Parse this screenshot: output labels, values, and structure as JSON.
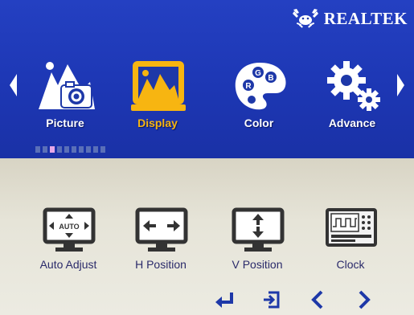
{
  "brand": {
    "name": "REALTEK",
    "logo_icon": "crab-logo-icon"
  },
  "colors": {
    "top_bg": "#1e38a8",
    "bottom_bg": "#e6e4d8",
    "active_label": "#f7b511",
    "label": "#ffffff",
    "sub_label": "#2a2a6a"
  },
  "main_menu": {
    "items": [
      {
        "label": "Picture",
        "icon": "picture-icon",
        "selected": false
      },
      {
        "label": "Display",
        "icon": "display-icon",
        "selected": true
      },
      {
        "label": "Color",
        "icon": "palette-icon",
        "selected": false
      },
      {
        "label": "Advance",
        "icon": "gears-icon",
        "selected": false
      }
    ],
    "page_count": 10,
    "current_page": 1
  },
  "submenu": {
    "items": [
      {
        "label": "Auto Adjust",
        "icon": "auto-adjust-icon",
        "badge": "AUTO"
      },
      {
        "label": "H Position",
        "icon": "h-position-icon"
      },
      {
        "label": "V Position",
        "icon": "v-position-icon"
      },
      {
        "label": "Clock",
        "icon": "clock-icon"
      }
    ]
  },
  "nav_buttons": [
    {
      "icon": "enter-icon"
    },
    {
      "icon": "exit-icon"
    },
    {
      "icon": "chevron-left-icon"
    },
    {
      "icon": "chevron-right-icon"
    }
  ]
}
